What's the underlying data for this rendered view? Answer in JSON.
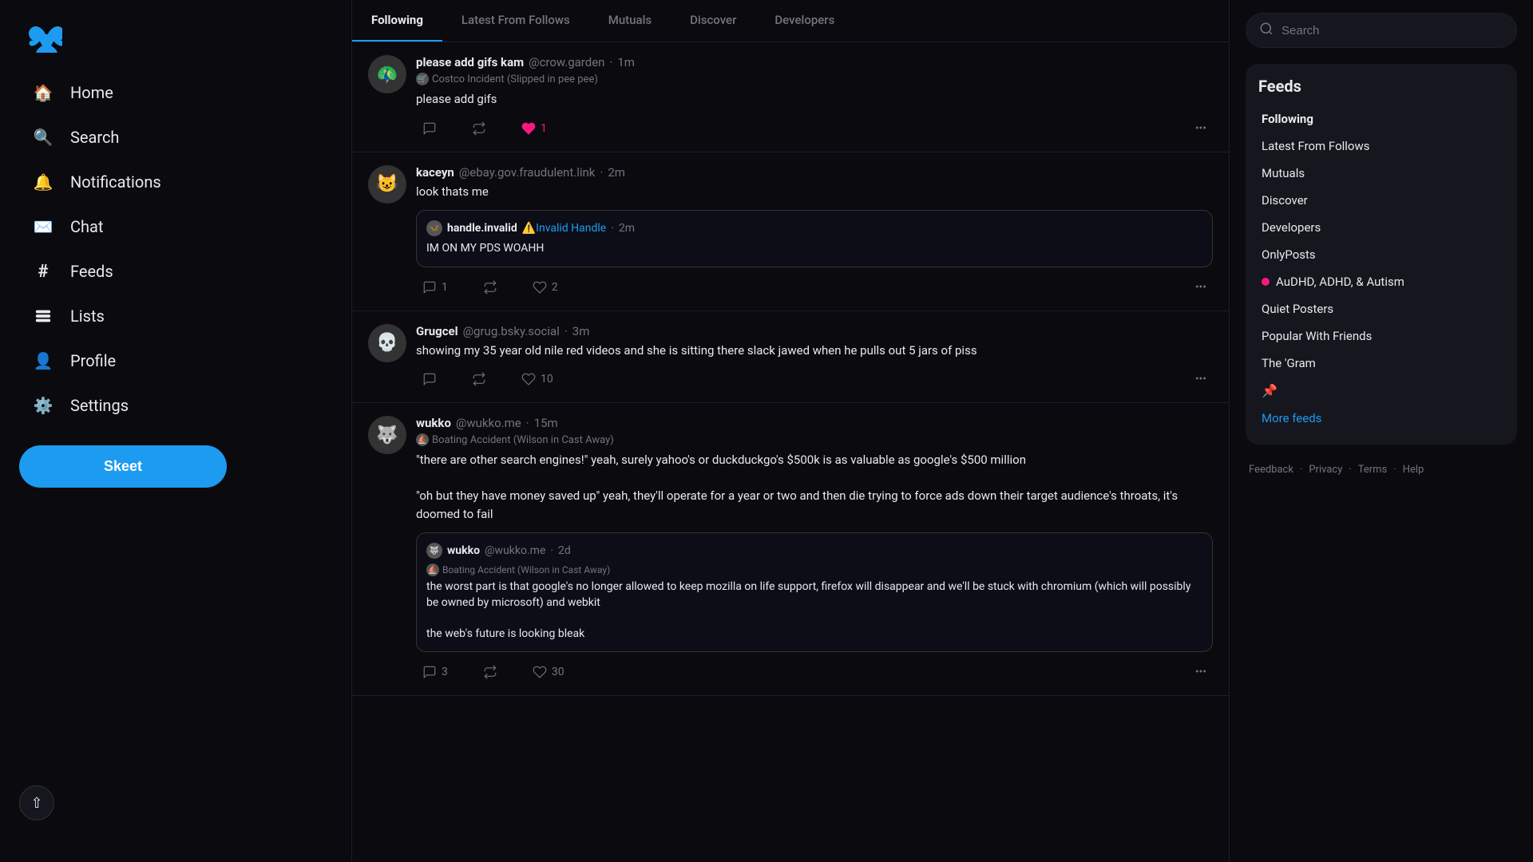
{
  "sidebar": {
    "logo_label": "Bluesky",
    "nav_items": [
      {
        "id": "home",
        "label": "Home",
        "icon": "🏠"
      },
      {
        "id": "search",
        "label": "Search",
        "icon": "🔍"
      },
      {
        "id": "notifications",
        "label": "Notifications",
        "icon": "🔔"
      },
      {
        "id": "chat",
        "label": "Chat",
        "icon": "✉️"
      },
      {
        "id": "feeds",
        "label": "Feeds",
        "icon": "#"
      },
      {
        "id": "lists",
        "label": "Lists",
        "icon": "☰"
      },
      {
        "id": "profile",
        "label": "Profile",
        "icon": "👤"
      },
      {
        "id": "settings",
        "label": "Settings",
        "icon": "⚙️"
      }
    ],
    "skeet_button_label": "Skeet",
    "scroll_top_label": "↑"
  },
  "tabs": [
    {
      "id": "following",
      "label": "Following",
      "active": true
    },
    {
      "id": "latest",
      "label": "Latest From Follows",
      "active": false
    },
    {
      "id": "mutuals",
      "label": "Mutuals",
      "active": false
    },
    {
      "id": "discover",
      "label": "Discover",
      "active": false
    },
    {
      "id": "developers",
      "label": "Developers",
      "active": false
    }
  ],
  "posts": [
    {
      "id": "post1",
      "avatar_emoji": "🦚",
      "display_name": "please add gifs kam",
      "handle": "@crow.garden",
      "time": "1m",
      "label": "Costco Incident (Slipped in pee pee)",
      "text": "please add gifs",
      "reply_count": "",
      "repost_count": "",
      "like_count": "1",
      "liked": true,
      "quoted": false
    },
    {
      "id": "post2",
      "avatar_emoji": "😺",
      "display_name": "kaceyn",
      "handle": "@ebay.gov.fraudulent.link",
      "time": "2m",
      "label": "",
      "text": "look thats me",
      "reply_count": "1",
      "repost_count": "",
      "like_count": "2",
      "liked": false,
      "quoted": true,
      "quote": {
        "avatar_emoji": "🦋",
        "display_name": "handle.invalid",
        "handle": "⚠️Invalid Handle",
        "time": "2m",
        "text": "IM ON MY PDS WOAHH"
      }
    },
    {
      "id": "post3",
      "avatar_emoji": "💀",
      "display_name": "Grugcel",
      "handle": "@grug.bsky.social",
      "time": "3m",
      "label": "",
      "text": "showing my 35 year old nile red videos and she is sitting there slack jawed when he pulls out 5 jars of piss",
      "reply_count": "",
      "repost_count": "",
      "like_count": "10",
      "liked": false,
      "quoted": false
    },
    {
      "id": "post4",
      "avatar_emoji": "🐺",
      "display_name": "wukko",
      "handle": "@wukko.me",
      "time": "15m",
      "label": "Boating Accident (Wilson in Cast Away)",
      "text": "\"there are other search engines!\" yeah, surely yahoo's or duckduckgo's $500k is as valuable as google's $500 million\n\n\"oh but they have money saved up\" yeah, they'll operate for a year or two and then die trying to force ads down their target audience's throats, it's doomed to fail",
      "reply_count": "3",
      "repost_count": "",
      "like_count": "30",
      "liked": false,
      "quoted": true,
      "quote": {
        "avatar_emoji": "🐺",
        "display_name": "wukko",
        "handle": "@wukko.me",
        "time": "2d",
        "label": "Boating Accident (Wilson in Cast Away)",
        "text": "the worst part is that google's no longer allowed to keep mozilla on life support, firefox will disappear and we'll be stuck with chromium (which will possibly be owned by microsoft) and webkit\n\nthe web's future is looking bleak"
      }
    }
  ],
  "right_sidebar": {
    "search_placeholder": "Search",
    "feeds_title": "Feeds",
    "feed_items": [
      {
        "id": "following",
        "label": "Following",
        "active": true,
        "icon": ""
      },
      {
        "id": "latest",
        "label": "Latest From Follows",
        "active": false,
        "icon": ""
      },
      {
        "id": "mutuals",
        "label": "Mutuals",
        "active": false,
        "icon": ""
      },
      {
        "id": "discover",
        "label": "Discover",
        "active": false,
        "icon": ""
      },
      {
        "id": "developers",
        "label": "Developers",
        "active": false,
        "icon": ""
      },
      {
        "id": "onlyposts",
        "label": "OnlyPosts",
        "active": false,
        "icon": ""
      },
      {
        "id": "audhd",
        "label": "AuDHD, ADHD, & Autism",
        "active": false,
        "icon": "dot"
      },
      {
        "id": "quiet",
        "label": "Quiet Posters",
        "active": false,
        "icon": ""
      },
      {
        "id": "popular",
        "label": "Popular With Friends",
        "active": false,
        "icon": ""
      },
      {
        "id": "gram",
        "label": "The 'Gram",
        "active": false,
        "icon": ""
      },
      {
        "id": "pinned",
        "label": "",
        "active": false,
        "icon": "pin"
      }
    ],
    "more_feeds_label": "More feeds",
    "footer": {
      "feedback": "Feedback",
      "privacy": "Privacy",
      "terms": "Terms",
      "help": "Help"
    }
  }
}
